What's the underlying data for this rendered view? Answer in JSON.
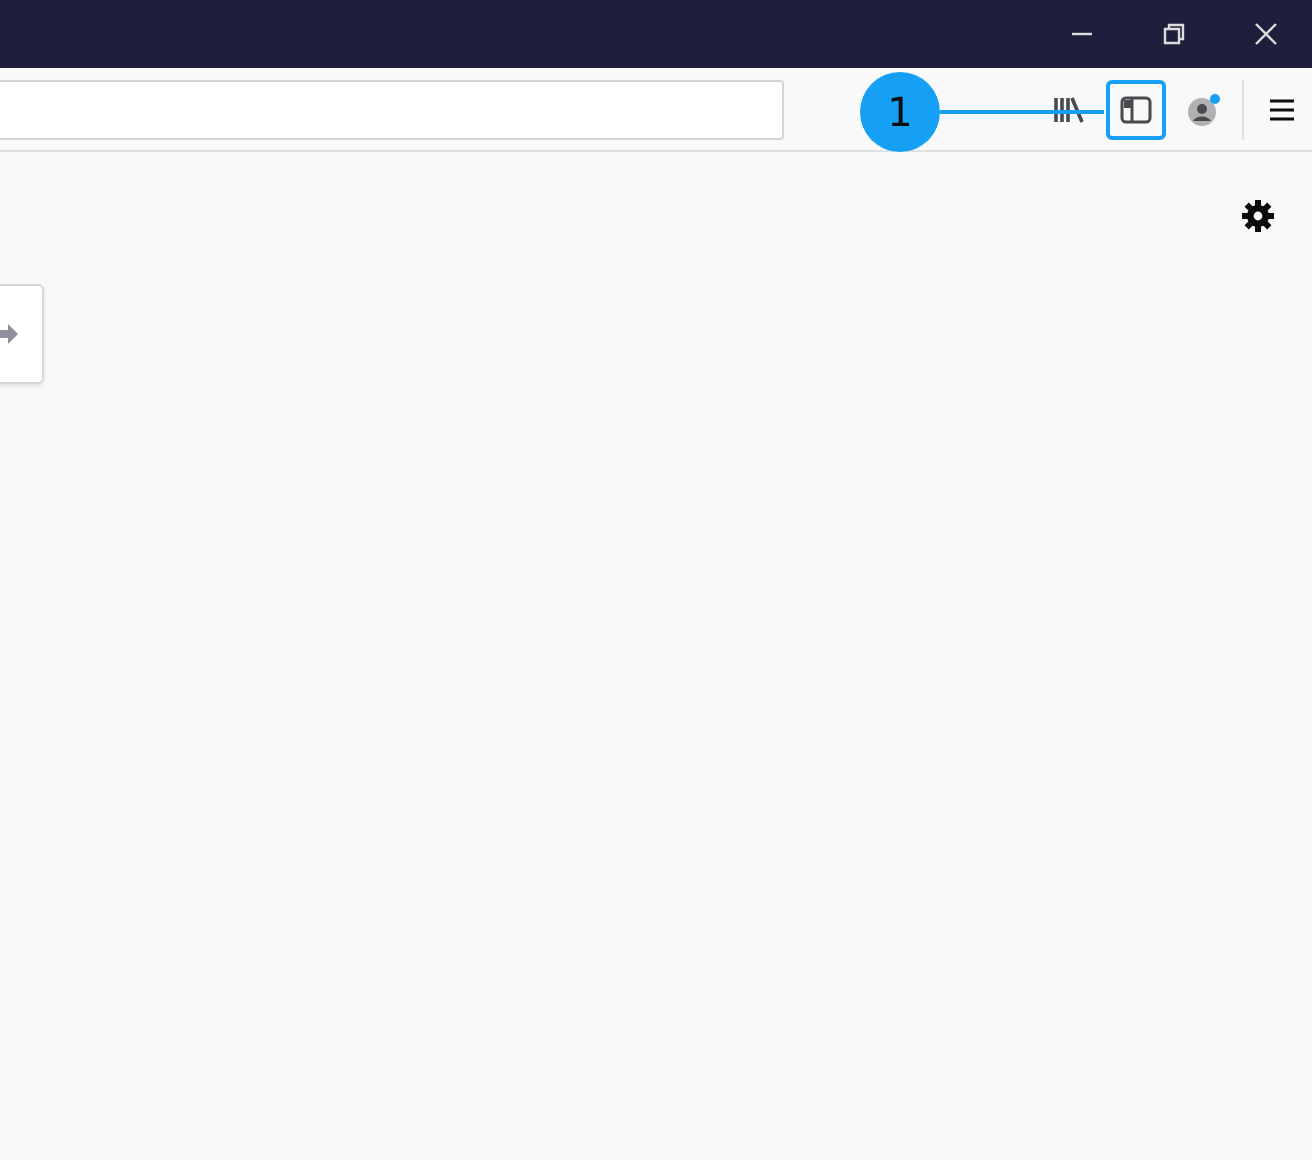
{
  "callout": {
    "label": "1"
  }
}
